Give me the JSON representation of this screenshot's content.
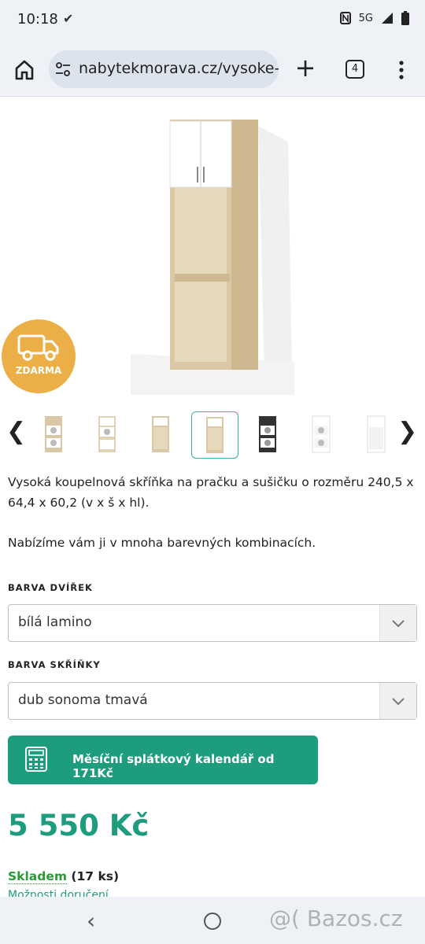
{
  "status": {
    "time": "10:18",
    "network": "5G"
  },
  "browser": {
    "url": "nabytekmorava.cz/vysoke-k",
    "tab_count": "4"
  },
  "badge": {
    "label": "ZDARMA",
    "icon": "truck-icon"
  },
  "product": {
    "description": "Vysoká koupelnová skříňka na pračku a sušičku o rozměru 240,5 x 64,4 x 60,2 (v x š x hl).",
    "description2": "Nabízíme vám ji v mnoha barevných kombinacích.",
    "door_color_label": "BARVA DVÍŘEK",
    "door_color_value": "bílá lamino",
    "cabinet_color_label": "BARVA SKŘÍŇKY",
    "cabinet_color_value": "dub sonoma tmavá",
    "calc_button_prefix": "Měsíční splátkový kalendář od ",
    "calc_button_amount": "171Kč",
    "price": "5 550 Kč",
    "stock_status": "Skladem",
    "stock_count": "(17 ks)",
    "delivery_link": "Možnosti doručení"
  },
  "watermark": "@( Bazos.cz",
  "colors": {
    "accent": "#1e9c7e",
    "badge": "#ecae46",
    "stock": "#2a9a37"
  }
}
